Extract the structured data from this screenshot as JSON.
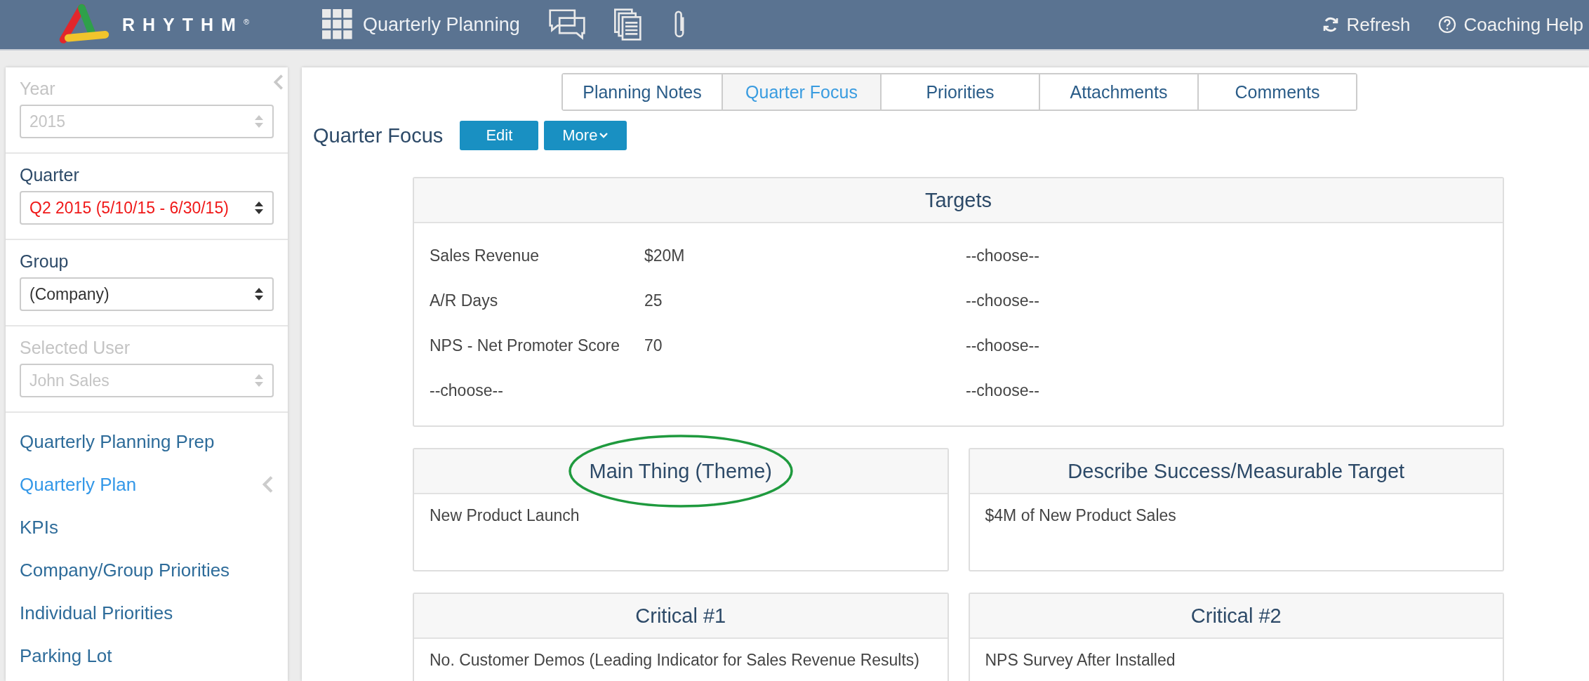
{
  "header": {
    "brand": "RHYTHM$^{®}$",
    "app_title": "Quarterly Planning",
    "actions": [
      {
        "kind": "refresh",
        "label": "Refresh"
      },
      {
        "kind": "help",
        "label": "Coaching Help"
      }
    ]
  },
  "sidebar": {
    "fields": [
      {
        "label": "Year",
        "value": "2015",
        "disabled": true,
        "alert": false
      },
      {
        "label": "Quarter",
        "value": "Q2 2015 (5/10/15 - 6/30/15)",
        "disabled": false,
        "alert": true
      },
      {
        "label": "Group",
        "value": "(Company)",
        "disabled": false,
        "alert": false
      },
      {
        "label": "Selected User",
        "value": "John Sales",
        "disabled": true,
        "alert": false
      }
    ],
    "items": [
      {
        "label": "Quarterly Planning Prep",
        "selected": false,
        "expandable": false
      },
      {
        "label": "Quarterly Plan",
        "selected": true,
        "expandable": true
      },
      {
        "label": "KPIs",
        "selected": false,
        "expandable": false
      },
      {
        "label": "Company/Group Priorities",
        "selected": false,
        "expandable": false
      },
      {
        "label": "Individual Priorities",
        "selected": false,
        "expandable": false
      },
      {
        "label": "Parking Lot",
        "selected": false,
        "expandable": false
      }
    ]
  },
  "tabs": [
    {
      "label": "Planning Notes",
      "selected": false
    },
    {
      "label": "Quarter Focus",
      "selected": true
    },
    {
      "label": "Priorities",
      "selected": false
    },
    {
      "label": "Attachments",
      "selected": false
    },
    {
      "label": "Comments",
      "selected": false
    }
  ],
  "section": {
    "title": "Quarter Focus",
    "buttons": [
      {
        "kind": "edit",
        "label": "Edit"
      },
      {
        "kind": "more",
        "label": "More"
      }
    ]
  },
  "targets": {
    "title": "Targets",
    "rows": [
      {
        "name": "Sales Revenue",
        "value": "$20M",
        "column_3": "--choose--"
      },
      {
        "name": "A/R Days",
        "value": "25",
        "column_3": "--choose--"
      },
      {
        "name": "NPS - Net Promoter Score",
        "value": "70",
        "column_3": "--choose--"
      },
      {
        "name": "--choose--",
        "value": "",
        "column_3": "--choose--"
      }
    ]
  },
  "cards": [
    {
      "title": "Main Thing (Theme)",
      "body": "New Product Launch",
      "circled": true
    },
    {
      "title": "Describe Success/Measurable Target",
      "body": "$4M of New Product Sales",
      "circled": false
    },
    {
      "title": "Critical #1",
      "body": "No. Customer Demos (Leading Indicator for Sales Revenue Results)",
      "circled": false
    },
    {
      "title": "Critical #2",
      "body": "NPS Survey After Installed",
      "circled": false
    }
  ]
}
